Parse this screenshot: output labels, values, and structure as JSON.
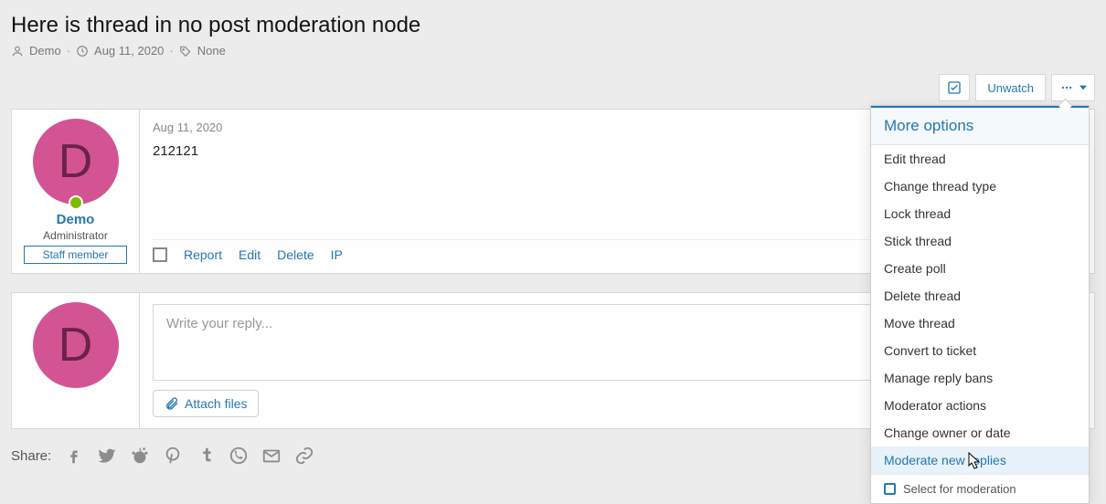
{
  "thread": {
    "title": "Here is thread in no post moderation node",
    "author": "Demo",
    "date": "Aug 11, 2020",
    "prefix": "None"
  },
  "actions": {
    "unwatch": "Unwatch"
  },
  "post": {
    "avatar_letter": "D",
    "user_name": "Demo",
    "user_role": "Administrator",
    "staff_badge": "Staff member",
    "date": "Aug 11, 2020",
    "content": "212121",
    "links": {
      "report": "Report",
      "edit": "Edit",
      "delete": "Delete",
      "ip": "IP"
    }
  },
  "reply": {
    "avatar_letter": "D",
    "placeholder": "Write your reply...",
    "attach": "Attach files"
  },
  "share": {
    "label": "Share:"
  },
  "dropdown": {
    "header": "More options",
    "items": [
      "Edit thread",
      "Change thread type",
      "Lock thread",
      "Stick thread",
      "Create poll",
      "Delete thread",
      "Move thread",
      "Convert to ticket",
      "Manage reply bans",
      "Moderator actions",
      "Change owner or date",
      "Moderate new replies"
    ],
    "hover_index": 11,
    "select_label": "Select for moderation"
  }
}
